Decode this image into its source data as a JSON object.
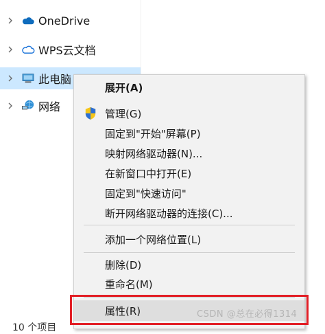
{
  "nav": {
    "items": [
      {
        "label": "OneDrive",
        "icon": "onedrive-cloud-icon"
      },
      {
        "label": "WPS云文档",
        "icon": "wps-cloud-icon"
      },
      {
        "label": "此电脑",
        "icon": "this-pc-icon"
      },
      {
        "label": "网络",
        "icon": "network-icon"
      }
    ],
    "status": "10 个项目"
  },
  "menu": {
    "expand": "展开(A)",
    "manage": "管理(G)",
    "pin_start": "固定到\"开始\"屏幕(P)",
    "map_drive": "映射网络驱动器(N)...",
    "open_new_window": "在新窗口中打开(E)",
    "pin_quick": "固定到\"快速访问\"",
    "disconnect_drive": "断开网络驱动器的连接(C)...",
    "add_network_location": "添加一个网络位置(L)",
    "delete": "删除(D)",
    "rename": "重命名(M)",
    "properties": "属性(R)"
  },
  "watermark": "CSDN @总在必得1314",
  "colors": {
    "selected": "#cce8ff",
    "menu_bg": "#f2f2f2",
    "highlight_border": "#e21f26"
  }
}
